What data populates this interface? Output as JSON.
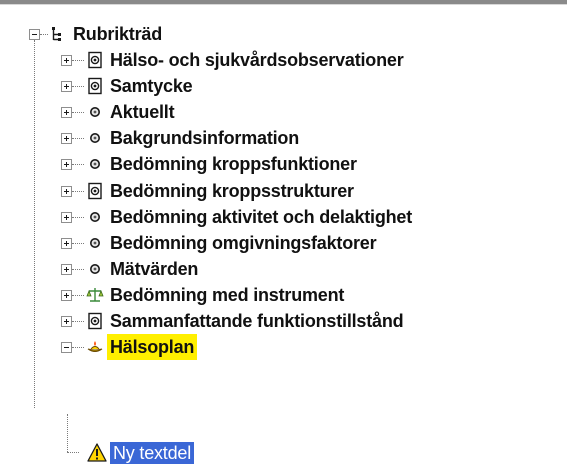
{
  "tree": {
    "root": {
      "label": "Rubrikträd",
      "icon": "tree-root-icon"
    },
    "items": [
      {
        "label": "Hälso- och sjukvårdsobservationer",
        "icon": "document-icon",
        "expanded": false
      },
      {
        "label": "Samtycke",
        "icon": "document-icon",
        "expanded": false
      },
      {
        "label": "Aktuellt",
        "icon": "bullet-icon",
        "expanded": false
      },
      {
        "label": "Bakgrundsinformation",
        "icon": "bullet-icon",
        "expanded": false
      },
      {
        "label": "Bedömning kroppsfunktioner",
        "icon": "bullet-icon",
        "expanded": false
      },
      {
        "label": "Bedömning kroppsstrukturer",
        "icon": "document-icon",
        "expanded": false
      },
      {
        "label": "Bedömning aktivitet och delaktighet",
        "icon": "bullet-icon",
        "expanded": false
      },
      {
        "label": "Bedömning omgivningsfaktorer",
        "icon": "bullet-icon",
        "expanded": false
      },
      {
        "label": "Mätvärden",
        "icon": "bullet-icon",
        "expanded": false
      },
      {
        "label": "Bedömning med instrument",
        "icon": "scales-icon",
        "expanded": false
      },
      {
        "label": "Sammanfattande funktionstillstånd",
        "icon": "document-icon",
        "expanded": false
      },
      {
        "label": "Hälsoplan",
        "icon": "lamp-icon",
        "expanded": true,
        "highlighted": true
      }
    ],
    "child": {
      "label": "Ny textdel",
      "icon": "warning-icon",
      "selected": true
    }
  },
  "colors": {
    "highlight": "#ffef00",
    "selection": "#3a67d6",
    "warning": "#ffd400"
  }
}
